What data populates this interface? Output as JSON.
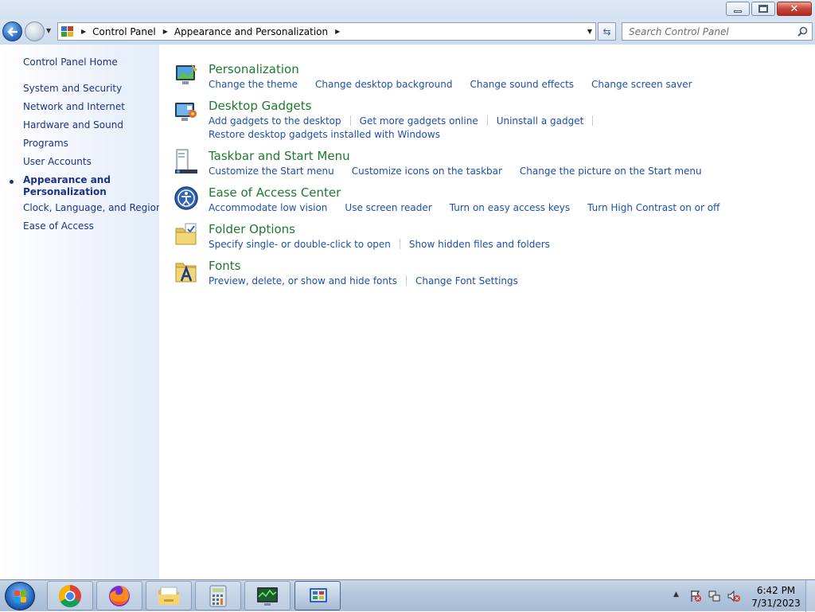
{
  "addressbar": {
    "crumbs": [
      "Control Panel",
      "Appearance and Personalization"
    ]
  },
  "search": {
    "placeholder": "Search Control Panel"
  },
  "leftpane": {
    "home": "Control Panel Home",
    "items": [
      "System and Security",
      "Network and Internet",
      "Hardware and Sound",
      "Programs",
      "User Accounts",
      "Appearance and Personalization",
      "Clock, Language, and Region",
      "Ease of Access"
    ],
    "current_index": 5
  },
  "categories": [
    {
      "title": "Personalization",
      "icon": "personalization-icon",
      "links": [
        [
          "Change the theme",
          "Change desktop background",
          "Change sound effects",
          "Change screen saver"
        ]
      ]
    },
    {
      "title": "Desktop Gadgets",
      "icon": "desktop-gadgets-icon",
      "links": [
        [
          "Add gadgets to the desktop",
          "Get more gadgets online",
          "Uninstall a gadget"
        ],
        [
          "Restore desktop gadgets installed with Windows"
        ]
      ]
    },
    {
      "title": "Taskbar and Start Menu",
      "icon": "taskbar-icon",
      "links": [
        [
          "Customize the Start menu",
          "Customize icons on the taskbar",
          "Change the picture on the Start menu"
        ]
      ]
    },
    {
      "title": "Ease of Access Center",
      "icon": "ease-of-access-icon",
      "links": [
        [
          "Accommodate low vision",
          "Use screen reader",
          "Turn on easy access keys",
          "Turn High Contrast on or off"
        ]
      ]
    },
    {
      "title": "Folder Options",
      "icon": "folder-options-icon",
      "links": [
        [
          "Specify single- or double-click to open",
          "Show hidden files and folders"
        ]
      ]
    },
    {
      "title": "Fonts",
      "icon": "fonts-icon",
      "links": [
        [
          "Preview, delete, or show and hide fonts",
          "Change Font Settings"
        ]
      ]
    }
  ],
  "taskbar": {
    "apps": [
      "chrome-icon",
      "firefox-icon",
      "file-explorer-icon",
      "calculator-icon",
      "system-monitor-icon",
      "control-panel-icon"
    ],
    "time": "6:42 PM",
    "date": "7/31/2023"
  },
  "colors": {
    "link": "#1e4fa8",
    "category_title": "#1e7a2f",
    "nav_link": "#1e3287"
  }
}
